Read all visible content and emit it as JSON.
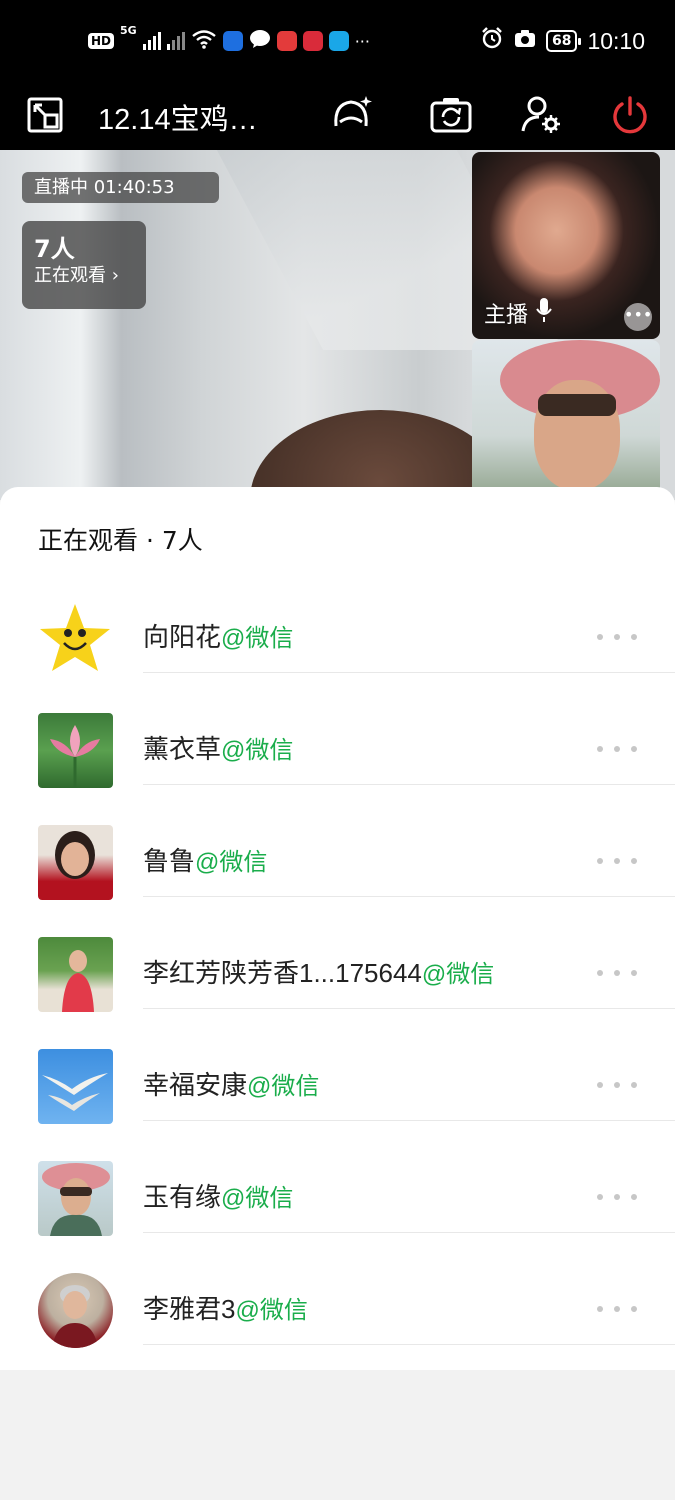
{
  "status_bar": {
    "hd_badge": "HD",
    "network": "5G",
    "battery": "68",
    "time": "10:10"
  },
  "title_bar": {
    "title": "12.14宝鸡…"
  },
  "stream": {
    "live_status": "直播中 01:40:53",
    "viewer_count": "7人",
    "viewer_label": "正在观看",
    "host_label": "主播"
  },
  "viewers_panel": {
    "header": "正在观看 · 7人",
    "source_tag": "@微信",
    "viewers": [
      {
        "name": "向阳花",
        "source": "@微信",
        "avatar": "smiling-star"
      },
      {
        "name": "薰衣草",
        "source": "@微信",
        "avatar": "lotus-flower"
      },
      {
        "name": "鲁鲁",
        "source": "@微信",
        "avatar": "portrait"
      },
      {
        "name": "李红芳陕芳香1...175644",
        "source": "@微信",
        "avatar": "garden-portrait"
      },
      {
        "name": "幸福安康",
        "source": "@微信",
        "avatar": "seagulls"
      },
      {
        "name": "玉有缘",
        "source": "@微信",
        "avatar": "pink-hat-portrait"
      },
      {
        "name": "李雅君3",
        "source": "@微信",
        "avatar": "round-portrait"
      }
    ]
  },
  "colors": {
    "accent_green": "#1aad4b",
    "power_red": "#e5383b"
  }
}
